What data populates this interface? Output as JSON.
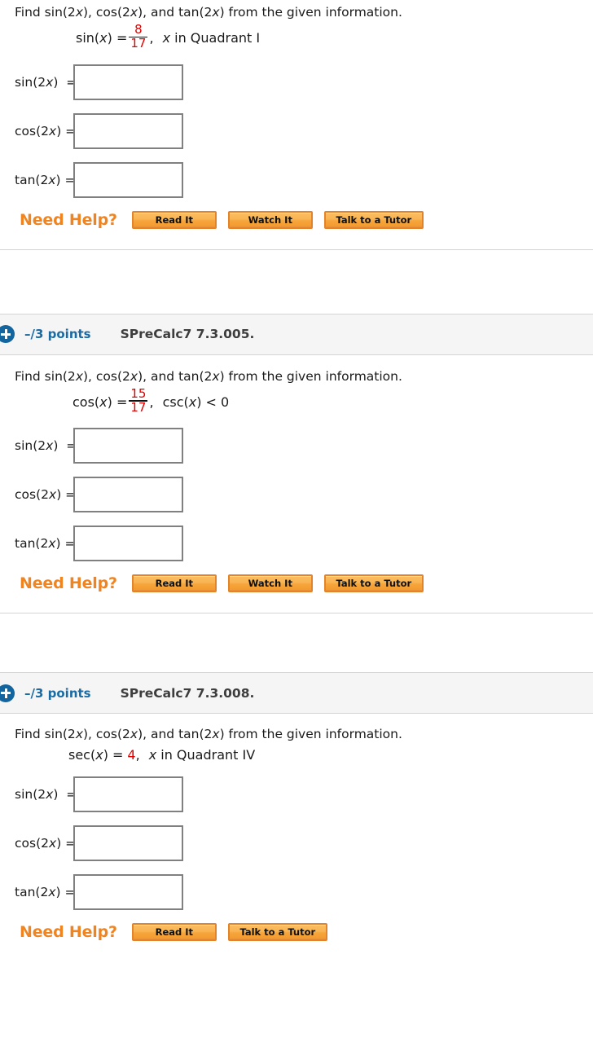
{
  "colors": {
    "accent_red": "#e00000",
    "need_help_orange": "#ef8420",
    "points_blue": "#1a6ba3",
    "plus_icon_blue": "#12659e",
    "button_face": "#f9b452",
    "button_border": "#e3842a",
    "header_band_bg": "#f5f5f5",
    "input_border": "#808080"
  },
  "common": {
    "prompt_prefix": "Find sin(2",
    "prompt": "Find sin(2x), cos(2x), and tan(2x) from the given information.",
    "need_help_label": "Need Help?",
    "answer_labels": {
      "sin": "sin(2x) =",
      "cos": "cos(2x) =",
      "tan": "tan(2x) ="
    },
    "buttons": {
      "read": "Read It",
      "watch": "Watch It",
      "tutor": "Talk to a Tutor"
    },
    "points": "–/3 points",
    "plus_icon": "plus-circle-icon"
  },
  "problems": [
    {
      "header_visible": false,
      "points": "–/3 points",
      "problem_id": "",
      "prompt": "Find sin(2x), cos(2x), and tan(2x) from the given information.",
      "given": {
        "function": "sin(x) =",
        "fraction": {
          "numerator": "8",
          "denominator": "17"
        },
        "comma": ",",
        "condition": "x in Quadrant I",
        "condition_italic_var": "x",
        "condition_rest": " in Quadrant I",
        "plain_value": ""
      },
      "answers": [
        {
          "label": "sin(2x)  =",
          "value": "",
          "placeholder": ""
        },
        {
          "label": "cos(2x) =",
          "value": "",
          "placeholder": ""
        },
        {
          "label": "tan(2x) =",
          "value": "",
          "placeholder": ""
        }
      ],
      "help_buttons": [
        "Read It",
        "Watch It",
        "Talk to a Tutor"
      ]
    },
    {
      "header_visible": true,
      "points": "–/3 points",
      "problem_id": "SPreCalc7 7.3.005.",
      "prompt": "Find sin(2x), cos(2x), and tan(2x) from the given information.",
      "given": {
        "function": "cos(x) =",
        "fraction": {
          "numerator": "15",
          "denominator": "17"
        },
        "comma": ",",
        "condition": "csc(x) < 0",
        "condition_italic_var": "x",
        "condition_rest": "",
        "plain_value": ""
      },
      "answers": [
        {
          "label": "sin(2x)  =",
          "value": "",
          "placeholder": ""
        },
        {
          "label": "cos(2x) =",
          "value": "",
          "placeholder": ""
        },
        {
          "label": "tan(2x) =",
          "value": "",
          "placeholder": ""
        }
      ],
      "help_buttons": [
        "Read It",
        "Watch It",
        "Talk to a Tutor"
      ]
    },
    {
      "header_visible": true,
      "points": "–/3 points",
      "problem_id": "SPreCalc7 7.3.008.",
      "prompt": "Find sin(2x), cos(2x), and tan(2x) from the given information.",
      "given": {
        "function": "sec(x) =",
        "fraction": null,
        "comma": ",",
        "condition": "x in Quadrant IV",
        "condition_italic_var": "x",
        "condition_rest": " in Quadrant IV",
        "plain_value": "4"
      },
      "answers": [
        {
          "label": "sin(2x)  =",
          "value": "",
          "placeholder": ""
        },
        {
          "label": "cos(2x) =",
          "value": "",
          "placeholder": ""
        },
        {
          "label": "tan(2x) =",
          "value": "",
          "placeholder": ""
        }
      ],
      "help_buttons": [
        "Read It",
        "Talk to a Tutor"
      ]
    }
  ]
}
